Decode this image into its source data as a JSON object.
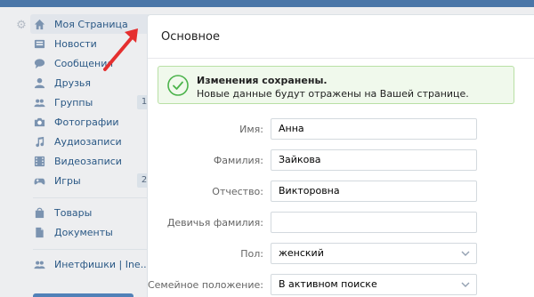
{
  "sidebar": {
    "items": [
      {
        "label": "Моя Страница",
        "icon": "home-icon",
        "badge": ""
      },
      {
        "label": "Новости",
        "icon": "news-icon",
        "badge": ""
      },
      {
        "label": "Сообщения",
        "icon": "messages-icon",
        "badge": ""
      },
      {
        "label": "Друзья",
        "icon": "friends-icon",
        "badge": ""
      },
      {
        "label": "Группы",
        "icon": "groups-icon",
        "badge": "1"
      },
      {
        "label": "Фотографии",
        "icon": "camera-icon",
        "badge": ""
      },
      {
        "label": "Аудиозаписи",
        "icon": "music-icon",
        "badge": ""
      },
      {
        "label": "Видеозаписи",
        "icon": "video-icon",
        "badge": ""
      },
      {
        "label": "Игры",
        "icon": "gamepad-icon",
        "badge": "2"
      },
      {
        "label": "Товары",
        "icon": "shopping-bag-icon",
        "badge": ""
      },
      {
        "label": "Документы",
        "icon": "document-icon",
        "badge": ""
      },
      {
        "label": "Инетфишки | Ine..",
        "icon": "community-icon",
        "badge": ""
      }
    ]
  },
  "main": {
    "title": "Основное",
    "notice": {
      "title": "Изменения сохранены.",
      "text": "Новые данные будут отражены на Вашей странице."
    },
    "fields": [
      {
        "label": "Имя:",
        "value": "Анна",
        "type": "text"
      },
      {
        "label": "Фамилия:",
        "value": "Зайкова",
        "type": "text"
      },
      {
        "label": "Отчество:",
        "value": "Викторовна",
        "type": "text"
      },
      {
        "label": "Девичья фамилия:",
        "value": "",
        "type": "text"
      },
      {
        "label": "Пол:",
        "value": "женский",
        "type": "select"
      },
      {
        "label": "Семейное положение:",
        "value": "В активном поиске",
        "type": "select"
      }
    ]
  },
  "colors": {
    "accent": "#4a76a8",
    "link": "#2a5885",
    "success_bg": "#f0f9ec",
    "success_border": "#b9e0a5",
    "arrow": "#e52f2f"
  }
}
